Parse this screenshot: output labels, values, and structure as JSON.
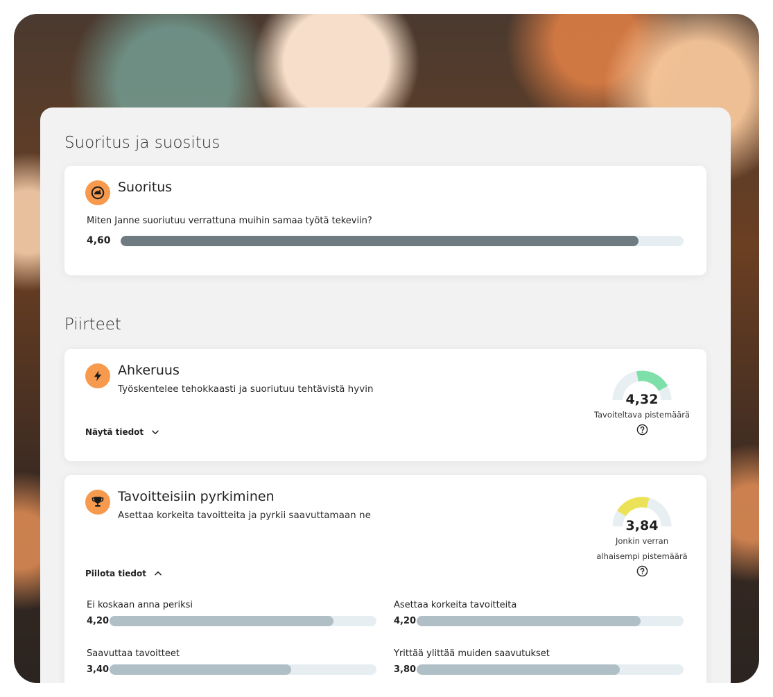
{
  "sections": {
    "performance_title": "Suoritus ja suositus",
    "traits_title": "Piirteet"
  },
  "performance_card": {
    "title": "Suoritus",
    "icon": "speedometer-icon",
    "question": "Miten Janne suoriutuu verrattuna muihin samaa työtä tekeviin?",
    "score": "4,60",
    "score_fraction": 0.92,
    "bar_color": "#6e7b80"
  },
  "traits": [
    {
      "title": "Ahkeruus",
      "icon": "lightning-icon",
      "description": "Työskentelee tehokkaasti ja suoriutuu tehtävistä hyvin",
      "toggle_label": "Näytä tiedot",
      "toggle_icon": "chevron-down-icon",
      "gauge_value": "4,32",
      "gauge_level": 0.64,
      "gauge_color": "#7fdfa8",
      "gauge_caption_line1": "Tavoiteltava pistemäärä",
      "gauge_caption_line2": ""
    },
    {
      "title": "Tavoitteisiin pyrkiminen",
      "icon": "trophy-icon",
      "description": "Asettaa korkeita tavoitteita ja pyrkii saavuttamaan ne",
      "toggle_label": "Piilota tiedot",
      "toggle_icon": "chevron-up-icon",
      "gauge_value": "3,84",
      "gauge_level": 0.38,
      "gauge_color": "#ece257",
      "gauge_caption_line1": "Jonkin verran",
      "gauge_caption_line2": "alhaisempi pistemäärä",
      "details": [
        {
          "label": "Ei koskaan anna periksi",
          "value": "4,20",
          "fraction": 0.84
        },
        {
          "label": "Asettaa korkeita tavoitteita",
          "value": "4,20",
          "fraction": 0.84
        },
        {
          "label": "Saavuttaa tavoitteet",
          "value": "3,40",
          "fraction": 0.68
        },
        {
          "label": "Yrittää ylittää muiden saavutukset",
          "value": "3,80",
          "fraction": 0.76
        }
      ]
    }
  ],
  "colors": {
    "accent": "#f79a4e",
    "detail_bar": "#b0bec5",
    "track": "#e6eef1",
    "gauge_track": "#e8eff2"
  }
}
